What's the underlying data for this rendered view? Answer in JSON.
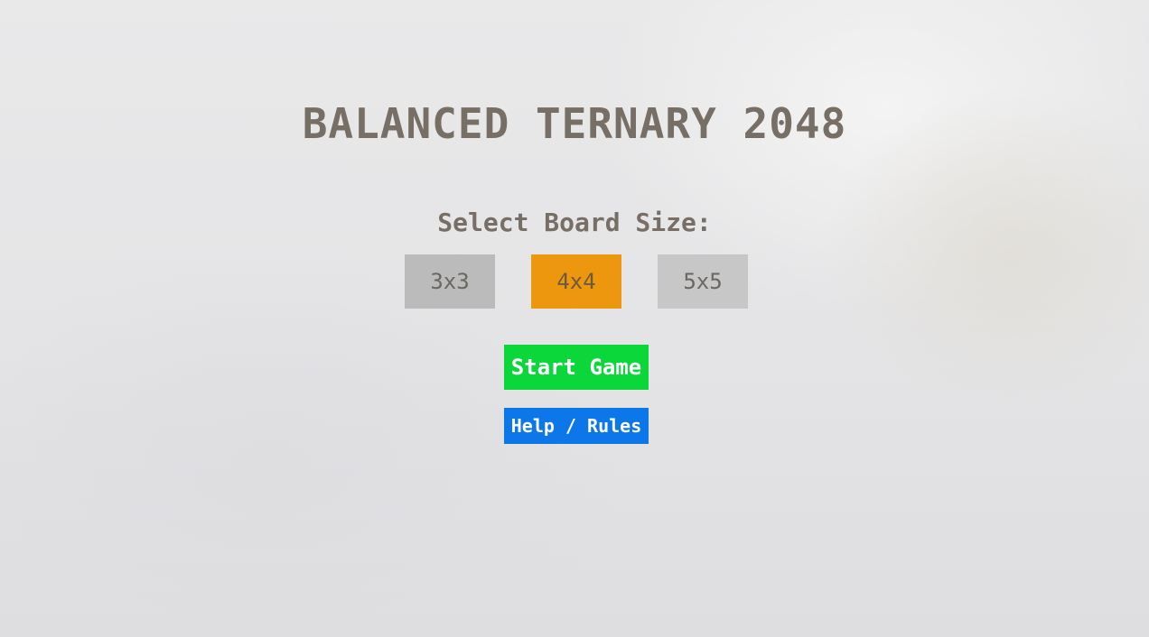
{
  "title": "BALANCED TERNARY 2048",
  "board_select": {
    "label": "Select Board Size:",
    "options": [
      "3x3",
      "4x4",
      "5x5"
    ],
    "selected": "4x4"
  },
  "actions": {
    "start_label": "Start Game",
    "help_label": "Help / Rules"
  },
  "colors": {
    "title_text": "#776e65",
    "option_default": "#bbbbbb",
    "option_selected": "#ed970f",
    "start_button": "#0bd63a",
    "help_button": "#0c77e8"
  }
}
